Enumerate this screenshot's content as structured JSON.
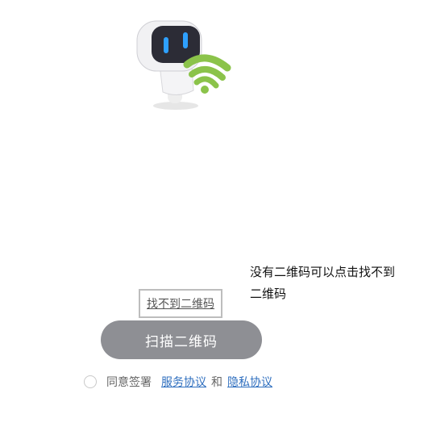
{
  "illustration": {
    "icon": "robot-wifi-icon"
  },
  "hint": {
    "text": "没有二维码可以点击找不到二维码"
  },
  "not_found": {
    "label": "找不到二维码"
  },
  "scan_button": {
    "label": "扫描二维码"
  },
  "agreement": {
    "prefix": "同意签署",
    "service_link": "服务协议",
    "conjunction": "和",
    "privacy_link": "隐私协议"
  },
  "colors": {
    "button_bg": "#8e8f94",
    "link": "#2f6fbf",
    "wifi_green": "#8bc34a"
  }
}
